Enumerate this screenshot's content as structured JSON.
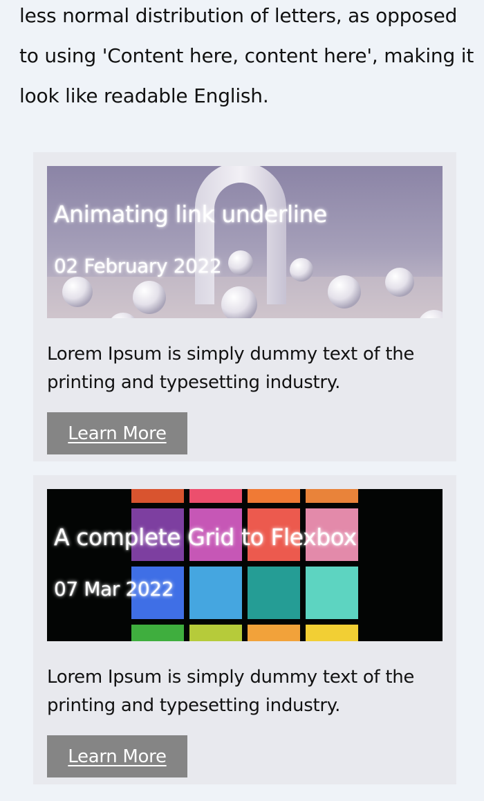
{
  "intro": {
    "text": "less normal distribution of letters, as opposed to using 'Content here, content here', making it look like readable English."
  },
  "cards": [
    {
      "title": "Animating link underline",
      "date": "02 February 2022",
      "description": "Lorem Ipsum is simply dummy text of the printing and typesetting industry.",
      "button_label": "Learn More"
    },
    {
      "title": "A complete Grid to Flexbox",
      "date": "07 Mar 2022",
      "description": "Lorem Ipsum is simply dummy text of the printing and typesetting industry.",
      "button_label": "Learn More"
    }
  ],
  "colors": {
    "page_bg": "#eff3f8",
    "card_bg": "#e8e9ee",
    "button_bg": "#858585"
  }
}
